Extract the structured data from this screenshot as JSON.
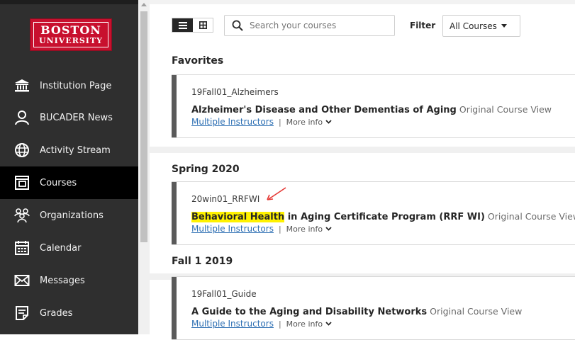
{
  "sidebar": {
    "logo": {
      "line1": "BOSTON",
      "line2": "UNIVERSITY"
    },
    "items": [
      {
        "label": "Institution Page",
        "icon": "institution-icon"
      },
      {
        "label": "BUCADER News",
        "icon": "user-icon"
      },
      {
        "label": "Activity Stream",
        "icon": "globe-icon"
      },
      {
        "label": "Courses",
        "icon": "courses-icon",
        "active": true
      },
      {
        "label": "Organizations",
        "icon": "organizations-icon"
      },
      {
        "label": "Calendar",
        "icon": "calendar-icon"
      },
      {
        "label": "Messages",
        "icon": "envelope-icon"
      },
      {
        "label": "Grades",
        "icon": "grades-icon"
      }
    ]
  },
  "toolbar": {
    "search_placeholder": "Search your courses",
    "filter_label": "Filter",
    "filter_value": "All Courses"
  },
  "sections": [
    {
      "title": "Favorites",
      "courses": [
        {
          "id": "19Fall01_Alzheimers",
          "name": "Alzheimer's Disease and Other Dementias of Aging",
          "view": "Original Course View",
          "instructors": "Multiple Instructors",
          "more": "More info"
        }
      ]
    },
    {
      "title": "Spring 2020",
      "courses": [
        {
          "id": "20win01_RRFWI",
          "name_highlight": "Behavioral Health",
          "name_rest": " in Aging Certificate Program (RRF WI)",
          "view": "Original Course View",
          "instructors": "Multiple Instructors",
          "more": "More info"
        }
      ]
    },
    {
      "title": "Fall 1 2019",
      "courses": [
        {
          "id": "19Fall01_Guide",
          "name": "A Guide to the Aging and Disability Networks",
          "view": "Original Course View",
          "instructors": "Multiple Instructors",
          "more": "More info"
        }
      ]
    }
  ],
  "colors": {
    "sidebar_bg": "#2f2f2f",
    "sidebar_active": "#000000",
    "brand_red": "#c8102e",
    "link": "#2d6fb3",
    "highlight": "#fff200",
    "annotation_arrow": "#e53935"
  }
}
